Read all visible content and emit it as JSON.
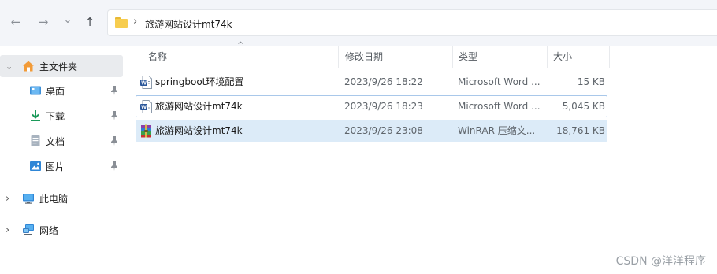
{
  "toolbar": {
    "back_icon": "←",
    "forward_icon": "→",
    "history_icon": "⌄",
    "up_icon": "↑"
  },
  "address": {
    "separator": "›",
    "folder_name": "旅游网站设计mt74k"
  },
  "sidebar": {
    "items": [
      {
        "label": "主文件夹",
        "chevron": "⌄",
        "icon": "home-icon"
      },
      {
        "label": "桌面",
        "icon": "desktop-icon",
        "pinned": true
      },
      {
        "label": "下载",
        "icon": "download-icon",
        "pinned": true
      },
      {
        "label": "文档",
        "icon": "document-icon",
        "pinned": true
      },
      {
        "label": "图片",
        "icon": "picture-icon",
        "pinned": true
      },
      {
        "label": "此电脑",
        "chevron": "›",
        "icon": "computer-icon"
      },
      {
        "label": "网络",
        "chevron": "›",
        "icon": "network-icon"
      }
    ],
    "pin_glyph": "📌"
  },
  "columns": {
    "name": "名称",
    "date": "修改日期",
    "type": "类型",
    "size": "大小",
    "sort_glyph": "^"
  },
  "files": [
    {
      "name": "springboot环境配置",
      "date": "2023/9/26 18:22",
      "type": "Microsoft Word ...",
      "size": "15 KB",
      "icon": "word-icon"
    },
    {
      "name": "旅游网站设计mt74k",
      "date": "2023/9/26 18:23",
      "type": "Microsoft Word ...",
      "size": "5,045 KB",
      "icon": "word-icon"
    },
    {
      "name": "旅游网站设计mt74k",
      "date": "2023/9/26 23:08",
      "type": "WinRAR 压缩文...",
      "size": "18,761 KB",
      "icon": "winrar-icon"
    }
  ],
  "watermark": "CSDN @洋洋程序",
  "colors": {
    "accent": "#0a64d6",
    "selection": "#dcebf8",
    "word_blue": "#2b579a",
    "folder_yellow": "#f7cd4f"
  }
}
